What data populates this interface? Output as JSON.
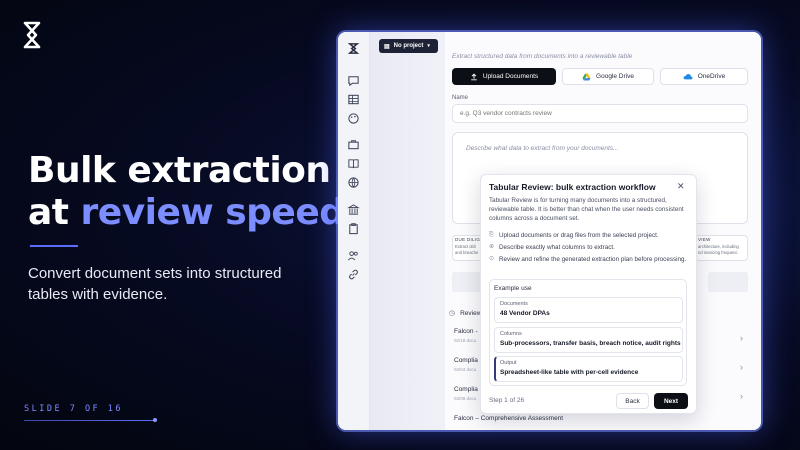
{
  "slide": {
    "headline_line1": "Bulk extraction",
    "headline_line2_pre": "at ",
    "headline_line2_accent": "review speed",
    "subtitle": "Convert document sets into structured tables with evidence.",
    "slide_number": "SLIDE 7 OF 16",
    "accent_color": "#7c8dff"
  },
  "app": {
    "project_button": "No project",
    "helper_text": "Extract structured data from documents into a reviewable table",
    "upload_buttons": {
      "upload": "Upload Documents",
      "google_drive": "Google Drive",
      "onedrive": "OneDrive"
    },
    "name_label": "Name",
    "name_placeholder": "e.g. Q3 vendor contracts review",
    "description_placeholder": "Describe what data to extract from your documents...",
    "bg_card_left": {
      "caption": "DUE DILIG",
      "line1": "Extract obli",
      "line2": "and breache"
    },
    "bg_card_right": {
      "caption": "VIEW",
      "line1": "architecture, including",
      "line2": "nd invoicing frequenc"
    },
    "reviews_heading": "Review",
    "reviews": [
      {
        "title": "Falcon -",
        "date": "02/18 docu"
      },
      {
        "title": "Complia",
        "date": "02/04 docu"
      },
      {
        "title": "Complia",
        "date": "02/09 docu"
      }
    ],
    "last_review": "Falcon – Comprehensive Assessment"
  },
  "dialog": {
    "title": "Tabular Review: bulk extraction workflow",
    "description": "Tabular Review is for turning many documents into a structured, reviewable table. It is better than chat when the user needs consistent columns across a document set.",
    "steps": [
      {
        "icon": "paperclip-icon",
        "glyph": "⎘",
        "text": "Upload documents or drag files from the selected project."
      },
      {
        "icon": "plus-circle-icon",
        "glyph": "⊕",
        "text": "Describe exactly what columns to extract."
      },
      {
        "icon": "check-circle-icon",
        "glyph": "⊙",
        "text": "Review and refine the generated extraction plan before processing."
      }
    ],
    "example_title": "Example use",
    "examples": [
      {
        "label": "Documents",
        "value": "48 Vendor DPAs"
      },
      {
        "label": "Columns",
        "value": "Sub-processors, transfer basis, breach notice, audit rights"
      },
      {
        "label": "Output",
        "value": "Spreadsheet-like table with per-cell evidence"
      }
    ],
    "step_count": "Step 1 of 26",
    "back_label": "Back",
    "next_label": "Next"
  }
}
